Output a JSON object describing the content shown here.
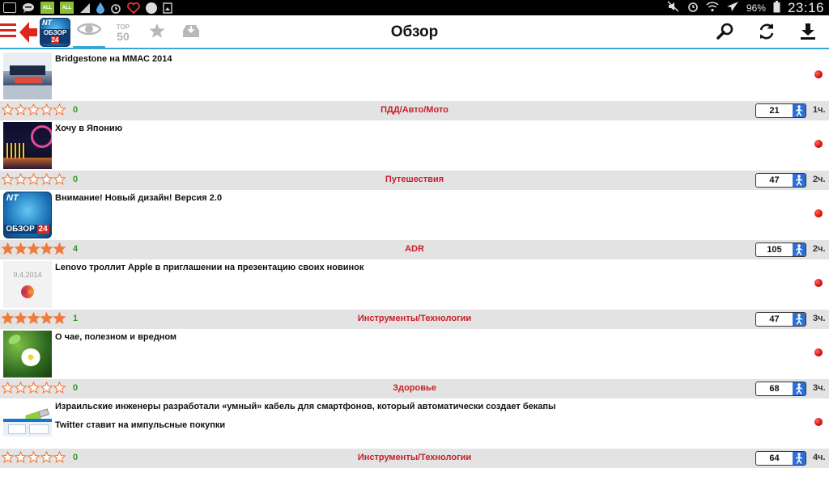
{
  "statusbar": {
    "left_icons": [
      "image-icon",
      "chat-icon",
      "all-widget-icon",
      "all-widget-icon",
      "signal-icon",
      "water-drop-icon",
      "alarm-icon",
      "heart-icon",
      "ball-icon",
      "gallery-icon"
    ],
    "all_badge": "ALL",
    "battery": "96%",
    "clock": "23:16"
  },
  "actionbar": {
    "title": "Обзор",
    "logo_nt": "NT",
    "logo_label": "ОБЗОР",
    "logo_num": "24",
    "top50_top": "TOP",
    "top50_num": "50",
    "accent": "#3aa7dc",
    "brand_red": "#d9261c"
  },
  "items": [
    {
      "title": "Bridgestone  на ММАС 2014",
      "rating": 0,
      "rating_count": "0",
      "category": "ПДД/Авто/Мото",
      "views": "21",
      "time": "1ч.",
      "thumb": "expo"
    },
    {
      "title": "Хочу в Японию",
      "rating": 0,
      "rating_count": "0",
      "category": "Путешествия",
      "views": "47",
      "time": "2ч.",
      "thumb": "night"
    },
    {
      "title": "Внимание! Новый дизайн! Версия 2.0",
      "rating": 5,
      "rating_count": "4",
      "category": "ADR",
      "views": "105",
      "time": "2ч.",
      "thumb": "logo"
    },
    {
      "title": "Lenovo троллит Apple в приглашении на презентацию своих новинок",
      "rating": 5,
      "rating_count": "1",
      "category": "Инструменты/Технологии",
      "views": "47",
      "time": "3ч.",
      "thumb": "lenovo",
      "thumb_text": "9.4.2014"
    },
    {
      "title": "О чае, полезном и вредном",
      "rating": 0,
      "rating_count": "0",
      "category": "Здоровье",
      "views": "68",
      "time": "3ч.",
      "thumb": "flower"
    },
    {
      "title": "Израильские инженеры разработали «умный» кабель для смартфонов, который автоматически создает бекапы",
      "rating": 0,
      "rating_count": "0",
      "category": "Инструменты/Технологии",
      "views": "64",
      "time": "4ч.",
      "thumb": "cable"
    }
  ],
  "partial_item": {
    "title": "Twitter ставит на импульсные покупки"
  },
  "colors": {
    "category": "#c8202a",
    "count": "#2f9a2f",
    "star": "#f07a3a",
    "meta_bg": "#e3e3e3"
  }
}
